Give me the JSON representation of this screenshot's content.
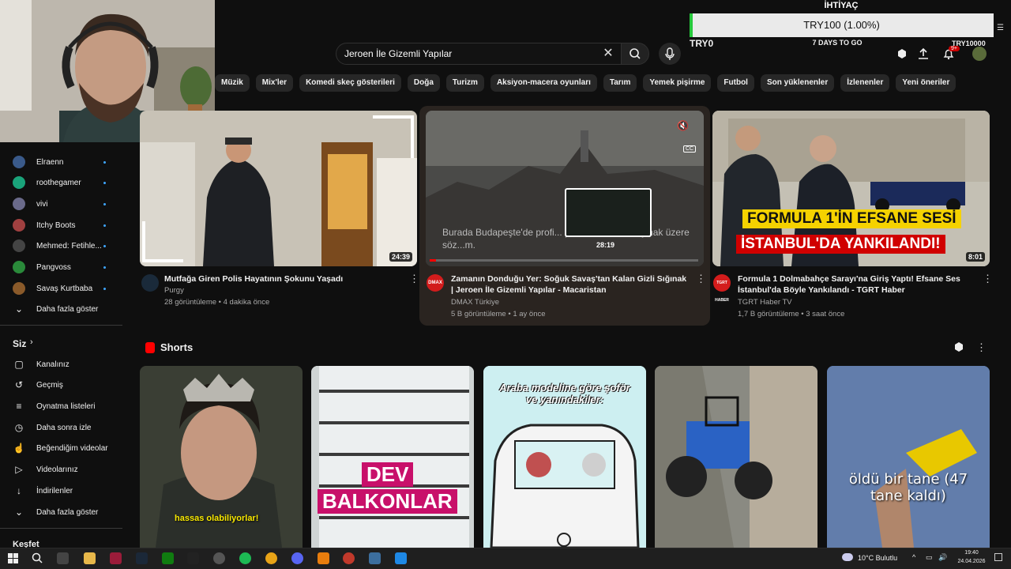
{
  "search": {
    "value": "Jeroen İle Gizemli Yapılar"
  },
  "chips": [
    "Müzik",
    "Mix'ler",
    "Komedi skeç gösterileri",
    "Doğa",
    "Turizm",
    "Aksiyon-macera oyunları",
    "Tarım",
    "Yemek pişirme",
    "Futbol",
    "Son yüklenenler",
    "İzlenenler",
    "Yeni öneriler"
  ],
  "goal": {
    "title": "İHTİYAÇ",
    "progress_text": "TRY100 (1.00%)",
    "start": "TRY0",
    "remaining": "7 DAYS TO GO",
    "target": "TRY10000",
    "progress_percent": 1.0
  },
  "notifications": {
    "badge": "9+"
  },
  "sidebar": {
    "subs": [
      {
        "name": "Elraenn",
        "color": "#3a5a8a"
      },
      {
        "name": "roothegamer",
        "color": "#1aa37a"
      },
      {
        "name": "vivi",
        "color": "#6a6a8a"
      },
      {
        "name": "Itchy Boots",
        "color": "#a04040"
      },
      {
        "name": "Mehmed: Fetihle...",
        "color": "#444"
      },
      {
        "name": "Pangvoss",
        "color": "#2a8a3a"
      },
      {
        "name": "Savaş Kurtbaba",
        "color": "#8a5a2a"
      }
    ],
    "more1": "Daha fazla göster",
    "you_header": "Siz",
    "you_items": [
      "Kanalınız",
      "Geçmiş",
      "Oynatma listeleri",
      "Daha sonra izle",
      "Beğendiğim videolar",
      "Videolarınız",
      "İndirilenler",
      "Daha fazla göster"
    ],
    "explore": "Keşfet"
  },
  "videos": [
    {
      "title": "Mutfağa Giren Polis Hayatının Şokunu Yaşadı",
      "channel": "Purgy",
      "meta": "28 görüntüleme • 4 dakika önce",
      "duration": "24:39"
    },
    {
      "title": "Zamanın Donduğu Yer: Soğuk Savaş'tan Kalan Gizli Sığınak | Jeroen İle Gizemli Yapılar - Macaristan",
      "channel": "DMAX Türkiye",
      "meta": "5 B görüntüleme • 1 ay önce",
      "duration": "28:19",
      "caption": "Burada Budapeşte'de profi... perest Bob'la buluşmak üzere söz...m.",
      "logo": "DMAX"
    },
    {
      "title": "Formula 1 Dolmabahçe Sarayı'na Giriş Yaptı! Efsane Ses İstanbul'da Böyle Yankılandı - TGRT Haber",
      "channel": "TGRT Haber TV",
      "meta": "1,7 B görüntüleme • 3 saat önce",
      "duration": "8:01",
      "banner1": "FORMULA 1'İN EFSANE SESİ",
      "banner2": "İSTANBUL'DA YANKILANDI!",
      "logo": "TGRT HABER"
    }
  ],
  "shorts": {
    "header": "Shorts",
    "items": [
      {
        "caption": "hassas olabiliyorlar!"
      },
      {
        "caption1": "DEV",
        "caption2": "BALKONLAR"
      },
      {
        "caption": "Araba modeline göre şoför ve yanındakiler:"
      },
      {
        "caption": ""
      },
      {
        "caption": "öldü bir tane (47 tane kaldı)"
      }
    ]
  },
  "taskbar": {
    "weather": "10°C  Bulutlu",
    "time": "19:40",
    "date": "24.04.2026"
  }
}
